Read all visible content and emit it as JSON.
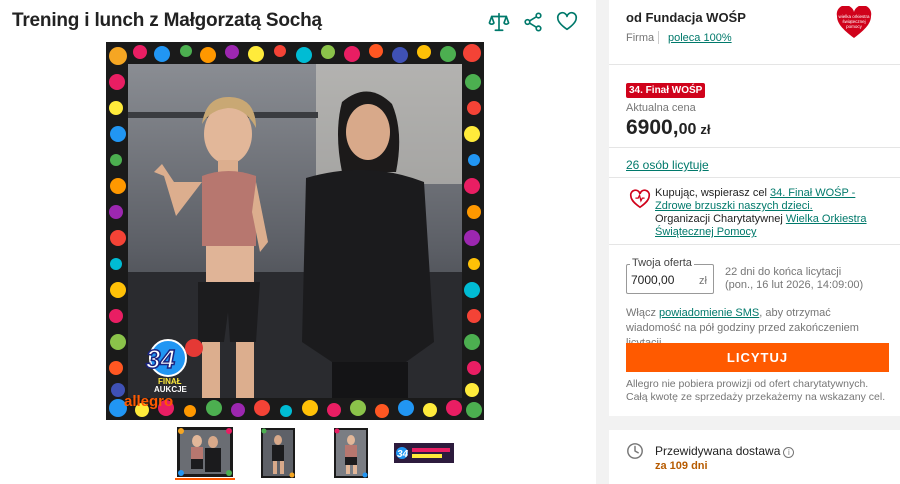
{
  "listing": {
    "title": "Trening i lunch z Małgorzatą Sochą"
  },
  "thumbnails": [
    {
      "name": "thumb-1",
      "active": true
    },
    {
      "name": "thumb-2",
      "active": false
    },
    {
      "name": "thumb-3",
      "active": false
    },
    {
      "name": "thumb-4",
      "active": false
    }
  ],
  "image_badge": {
    "number": "34",
    "line1": "FINAŁ",
    "line2": "AUKCJE",
    "brand": "allegro"
  },
  "seller": {
    "label": "od Fundacja WOŚP",
    "type": "Firma",
    "recommend": "poleca 100%",
    "logo_text": "wielka orkiestra świątecznej pomocy"
  },
  "price_block": {
    "badge": "34. Finał WOŚP",
    "label": "Aktualna cena",
    "main": "6900,",
    "cents": "00",
    "currency": "zł"
  },
  "bidders": "26 osób licytuje",
  "charity": {
    "prefix": "Kupując, wspierasz cel ",
    "goal": "34. Finał WOŚP - Zdrowe brzuszki naszych dzieci.",
    "org_prefix": "Organizacji Charytatywnej ",
    "org": "Wielka Orkiestra Świątecznej Pomocy"
  },
  "offer": {
    "legend": "Twoja oferta",
    "value": "7000,00",
    "currency": "zł",
    "days_left": "22 dni do końca licytacji",
    "end_date": "(pon., 16 lut 2026, 14:09:00)"
  },
  "sms": {
    "prefix": "Włącz ",
    "link": "powiadomienie SMS",
    "suffix": ", aby otrzymać wiadomość na pół godziny przed zakończeniem licytacji."
  },
  "bid_button": "LICYTUJ",
  "note": "Allegro nie pobiera prowizji od ofert charytatywnych. Całą kwotę ze sprzedaży przekażemy na wskazany cel.",
  "delivery": {
    "label": "Przewidywana dostawa",
    "info": "i",
    "time": "za 109 dni"
  },
  "colors": {
    "accent": "#ff5a00",
    "link": "#00796b",
    "badge": "#d0021b",
    "delivery": "#b75b00"
  }
}
